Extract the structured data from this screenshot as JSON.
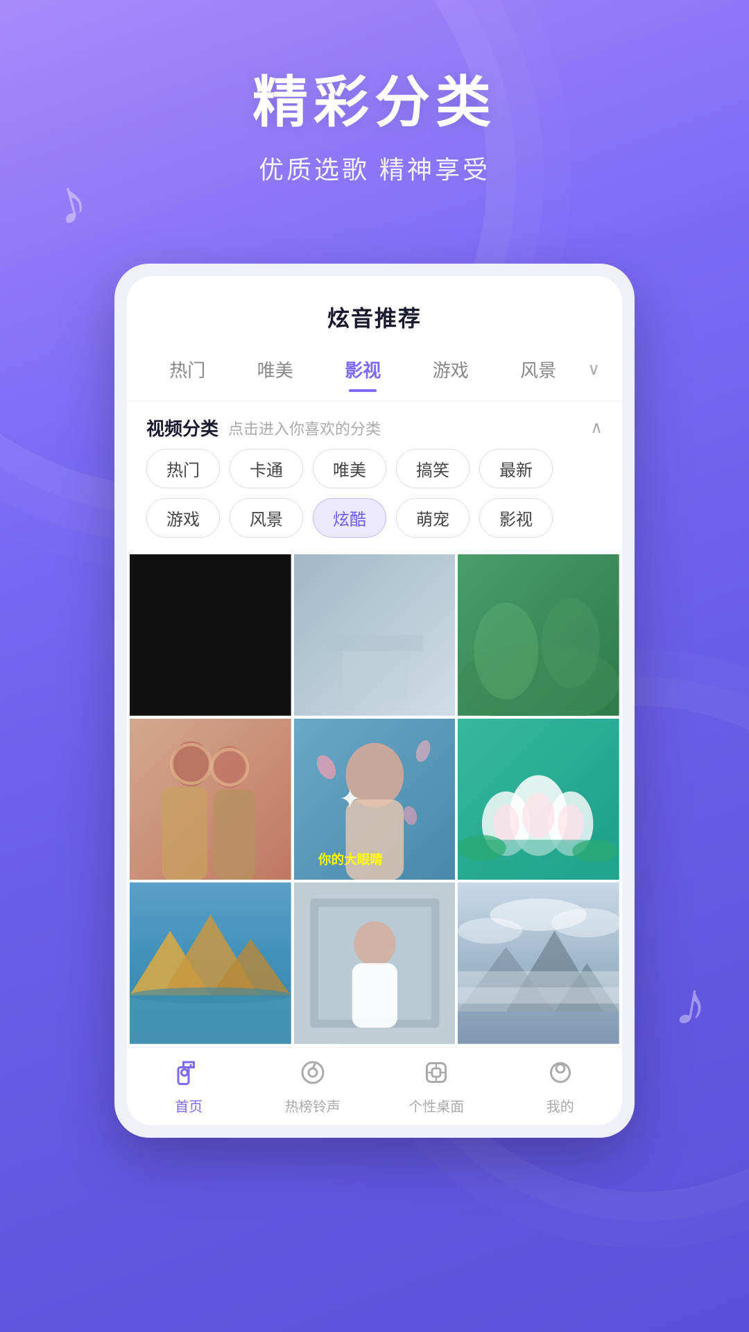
{
  "hero": {
    "title": "精彩分类",
    "subtitle": "优质选歌 精神享受"
  },
  "card": {
    "header": "炫音推荐",
    "tabs": [
      {
        "label": "热门",
        "active": false
      },
      {
        "label": "唯美",
        "active": false
      },
      {
        "label": "影视",
        "active": true
      },
      {
        "label": "游戏",
        "active": false
      },
      {
        "label": "风景",
        "active": false
      }
    ],
    "tab_more": "∨",
    "category_section": {
      "title": "视频分类",
      "hint": "点击进入你喜欢的分类",
      "collapse_icon": "∧",
      "tags": [
        {
          "label": "热门",
          "active": false
        },
        {
          "label": "卡通",
          "active": false
        },
        {
          "label": "唯美",
          "active": false
        },
        {
          "label": "搞笑",
          "active": false
        },
        {
          "label": "最新",
          "active": false
        },
        {
          "label": "游戏",
          "active": false
        },
        {
          "label": "风景",
          "active": false
        },
        {
          "label": "炫酷",
          "active": true
        },
        {
          "label": "萌宠",
          "active": false
        },
        {
          "label": "影视",
          "active": false
        }
      ]
    },
    "videos": [
      {
        "type": "black",
        "row": 0
      },
      {
        "type": "blue-gray",
        "row": 0
      },
      {
        "type": "green",
        "row": 0
      },
      {
        "type": "women",
        "row": 1
      },
      {
        "type": "girl-sparkle",
        "row": 1
      },
      {
        "type": "lotus",
        "row": 1
      },
      {
        "type": "lake",
        "row": 2
      },
      {
        "type": "indoor-girl",
        "row": 2
      },
      {
        "type": "mist",
        "row": 2
      }
    ],
    "bottom_nav": [
      {
        "label": "首页",
        "icon": "▶",
        "active": true,
        "icon_type": "video-play"
      },
      {
        "label": "热榜铃声",
        "icon": "♪",
        "active": false,
        "icon_type": "music-note"
      },
      {
        "label": "个性桌面",
        "icon": "⊕",
        "active": false,
        "icon_type": "desktop"
      },
      {
        "label": "我的",
        "icon": "☺",
        "active": false,
        "icon_type": "person"
      }
    ]
  },
  "colors": {
    "accent": "#7c6af5",
    "text_primary": "#1a1a2e",
    "text_secondary": "#888888",
    "bg_gradient_start": "#a78bfa",
    "bg_gradient_end": "#5b50d9"
  }
}
